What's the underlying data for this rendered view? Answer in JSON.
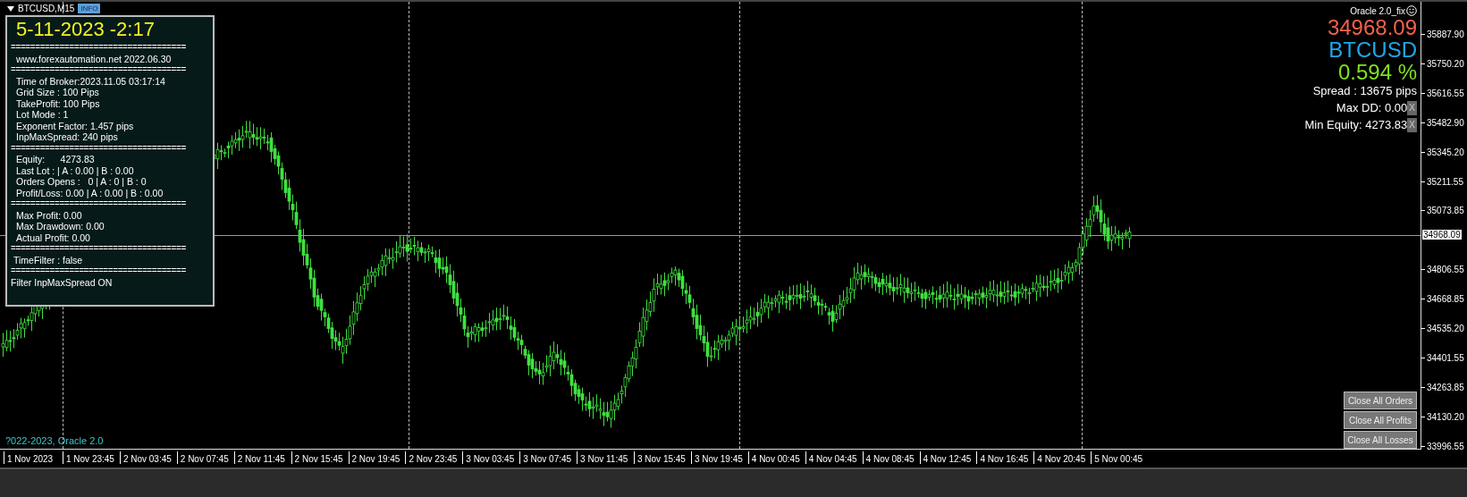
{
  "chart_tab": {
    "symbol": "BTCUSD,M15",
    "badge": "INFO"
  },
  "info_panel": {
    "datetime": "5-11-2023 -2:17",
    "lines": [
      {
        "kind": "separator",
        "text": "===================================="
      },
      {
        "kind": "item",
        "text": "www.forexautomation.net 2022.06.30"
      },
      {
        "kind": "separator",
        "text": "===================================="
      },
      {
        "kind": "item",
        "text": "Time of Broker:2023.11.05 03:17:14"
      },
      {
        "kind": "item",
        "text": "Grid Size : 100 Pips"
      },
      {
        "kind": "item",
        "text": "TakeProfit: 100 Pips"
      },
      {
        "kind": "item",
        "text": "Lot Mode : 1"
      },
      {
        "kind": "item",
        "text": "Exponent Factor: 1.457 pips"
      },
      {
        "kind": "item",
        "text": "InpMaxSpread: 240 pips"
      },
      {
        "kind": "separator",
        "text": "===================================="
      },
      {
        "kind": "item",
        "text": "Equity:      4273.83"
      },
      {
        "kind": "item",
        "text": "Last Lot : | A : 0.00 | B : 0.00"
      },
      {
        "kind": "item",
        "text": "Orders Opens :   0 | A : 0 | B : 0"
      },
      {
        "kind": "item",
        "text": "Profit/Loss: 0.00 | A : 0.00 | B : 0.00"
      },
      {
        "kind": "separator",
        "text": "===================================="
      },
      {
        "kind": "item",
        "text": "Max Profit: 0.00"
      },
      {
        "kind": "item",
        "text": "Max Drawdown: 0.00"
      },
      {
        "kind": "item",
        "text": "Actual Profit: 0.00"
      },
      {
        "kind": "separator",
        "text": "===================================="
      },
      {
        "kind": "note",
        "text": "TimeFilter : false"
      },
      {
        "kind": "separator",
        "text": "===================================="
      },
      {
        "kind": "plain",
        "text": "Filter InpMaxSpread ON"
      }
    ]
  },
  "status_panel": {
    "title": "Oracle 2.0_fix",
    "price": "34968.09",
    "symbol": "BTCUSD",
    "change": "0.594 %",
    "spread": "Spread : 13675 pips",
    "stats": [
      {
        "label": "Max DD: 0.00",
        "close": "X"
      },
      {
        "label": "Min Equity: 4273.83",
        "close": "X"
      }
    ]
  },
  "buttons": [
    "Close All Orders",
    "Close All Profits",
    "Close All Losses"
  ],
  "copyright": "?022-2023, Oracle 2.0",
  "price_axis": {
    "current": "34968.09",
    "labels": [
      "35887.90",
      "35750.20",
      "35616.55",
      "35482.90",
      "35345.20",
      "35211.55",
      "35073.85",
      "34806.55",
      "34668.85",
      "34535.20",
      "34401.55",
      "34263.85",
      "34130.20",
      "33996.55"
    ]
  },
  "time_axis": [
    "1 Nov 2023",
    "1 Nov 23:45",
    "2 Nov 03:45",
    "2 Nov 07:45",
    "2 Nov 11:45",
    "2 Nov 15:45",
    "2 Nov 19:45",
    "2 Nov 23:45",
    "3 Nov 03:45",
    "3 Nov 07:45",
    "3 Nov 11:45",
    "3 Nov 15:45",
    "3 Nov 19:45",
    "4 Nov 00:45",
    "4 Nov 04:45",
    "4 Nov 08:45",
    "4 Nov 12:45",
    "4 Nov 16:45",
    "4 Nov 20:45",
    "5 Nov 00:45"
  ]
}
